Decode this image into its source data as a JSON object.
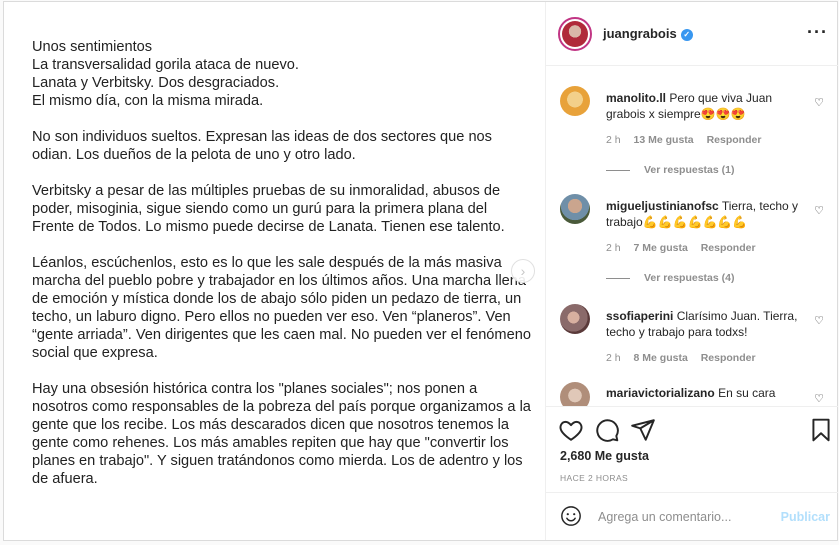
{
  "media": {
    "paragraphs": [
      "Unos sentimientos\nLa transversalidad gorila ataca de nuevo.\nLanata y Verbitsky. Dos desgraciados.\nEl mismo día, con la misma mirada.",
      "No son individuos sueltos. Expresan las ideas de dos sectores que nos odian. Los dueños de la pelota de uno y otro lado.",
      "Verbitsky a pesar de las múltiples pruebas de su inmoralidad, abusos de poder, misoginia, sigue siendo como un gurú para la primera plana del Frente de Todos. Lo mismo puede decirse de Lanata. Tienen ese talento.",
      "Léanlos, escúchenlos, esto es lo que les sale después de la más masiva marcha del pueblo pobre y trabajador en los últimos años. Una marcha llena de emoción y mística donde los de abajo sólo piden un pedazo de tierra, un techo, un laburo digno. Pero ellos no pueden ver eso. Ven “planeros”. Ven “gente arriada”. Ven dirigentes que les caen mal. No pueden ver el fenómeno social que expresa.",
      "Hay una obsesión histórica contra los \"planes sociales\"; nos ponen a nosotros como responsables de la pobreza del país porque organizamos a la gente que los recibe. Los más descarados dicen que nosotros tenemos la gente como rehenes. Los más amables repiten que hay que \"convertir los planes en trabajo\". Y siguen tratándonos como mierda. Los de adentro y los de afuera."
    ],
    "next_icon": "chevron-right-icon"
  },
  "header": {
    "username": "juangrabois",
    "verified_icon": "verified-badge-icon",
    "more_icon": "more-options-icon",
    "more_glyph": "···"
  },
  "comments": [
    {
      "username": "manolito.ll",
      "text": "Pero que viva Juan grabois x siempre😍😍😍",
      "time": "2 h",
      "likes": "13 Me gusta",
      "reply": "Responder",
      "view_replies": "Ver respuestas (1)",
      "avatar_color": "#e8a23a"
    },
    {
      "username": "migueljustinianofsc",
      "text": "Tierra, techo y trabajo💪💪💪💪💪💪💪",
      "time": "2 h",
      "likes": "7 Me gusta",
      "reply": "Responder",
      "view_replies": "Ver respuestas (4)",
      "avatar_color": "#7a5a4a"
    },
    {
      "username": "ssofiaperini",
      "text": "Clarísimo Juan. Tierra, techo y trabajo para todxs!",
      "time": "2 h",
      "likes": "8 Me gusta",
      "reply": "Responder",
      "avatar_color": "#8a6a6a"
    },
    {
      "username": "mariavictorializano",
      "text": "En su cara",
      "avatar_color": "#b08e7a"
    }
  ],
  "actions": {
    "likes_count": "2,680 Me gusta",
    "time_ago": "HACE 2 HORAS"
  },
  "add_comment": {
    "placeholder": "Agrega un comentario...",
    "publish_label": "Publicar"
  },
  "colors": {
    "accent_blue": "#3897f0",
    "publish_disabled": "#b2dffc",
    "border": "#dbdbdb"
  }
}
